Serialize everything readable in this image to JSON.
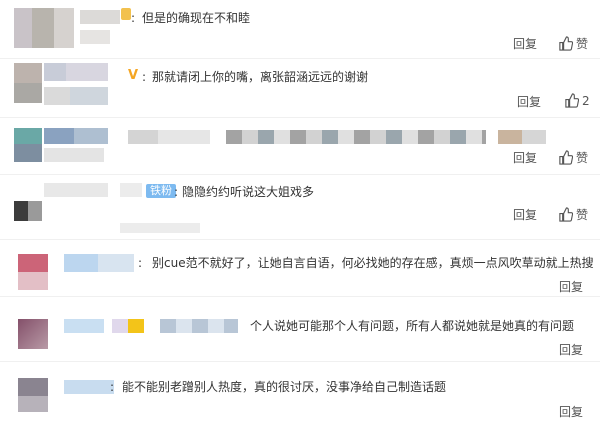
{
  "comments": [
    {
      "text": "但是的确现在不和睦",
      "reply": "回复",
      "like": "赞"
    },
    {
      "text": "那就请闭上你的嘴，离张韶涵远远的谢谢",
      "reply": "回复",
      "likes": "2",
      "badge_v": "V"
    },
    {
      "reply": "回复",
      "like": "赞"
    },
    {
      "text": "隐隐约约听说这大姐戏多",
      "reply": "回复",
      "like": "赞",
      "badge": "铁粉"
    },
    {
      "text": "别cue范不就好了，让她自言自语，何必找她的存在感，真烦一点风吹草动就上热搜",
      "reply": "回复"
    },
    {
      "text": "个人说她可能那个人有问题，所有人都说她就是她真的有问题",
      "reply": "回复"
    },
    {
      "text": "能不能别老蹭别人热度，真的很讨厌，没事净给自己制造话题",
      "reply": "回复"
    }
  ],
  "colors": {
    "badge": "#7dbaf0",
    "vip": "#f5a623",
    "text": "#333333",
    "muted": "#555555"
  },
  "icons": [
    "thumbs-up-icon"
  ]
}
